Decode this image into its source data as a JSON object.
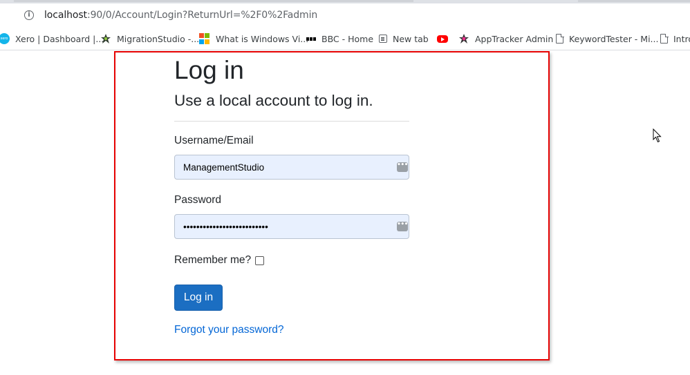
{
  "browser": {
    "url_host": "localhost",
    "url_rest": ":90/0/Account/Login?ReturnUrl=%2F0%2Fadmin",
    "info_icon_glyph": "i",
    "bookmarks": [
      {
        "label": "Xero | Dashboard |...",
        "icon": "xero-icon",
        "icon_text": "xero"
      },
      {
        "label": "MigrationStudio -...",
        "icon": "migrationstudio-icon"
      },
      {
        "label": "What is Windows Vi...",
        "icon": "microsoft-icon"
      },
      {
        "label": "BBC - Home",
        "icon": "bbc-icon"
      },
      {
        "label": "New tab",
        "icon": "new-tab-icon"
      },
      {
        "label": "",
        "icon": "youtube-icon"
      },
      {
        "label": "AppTracker Admin",
        "icon": "apptracker-icon"
      },
      {
        "label": "KeywordTester - Mi...",
        "icon": "document-icon"
      },
      {
        "label": "Intro",
        "icon": "document-icon"
      }
    ]
  },
  "page": {
    "title": "Log in",
    "subtitle": "Use a local account to log in.",
    "username_label": "Username/Email",
    "username_value": "ManagementStudio",
    "password_label": "Password",
    "password_value": "••••••••••••••••••••••••••",
    "remember_label": "Remember me?",
    "remember_checked": false,
    "login_button": "Log in",
    "forgot_link": "Forgot your password?",
    "password_manager_glyph": "•••"
  },
  "colors": {
    "highlight_frame": "#e60000",
    "primary_button": "#1b6ec2",
    "link": "#0366d6",
    "autofill_bg": "#e8f0fe"
  }
}
